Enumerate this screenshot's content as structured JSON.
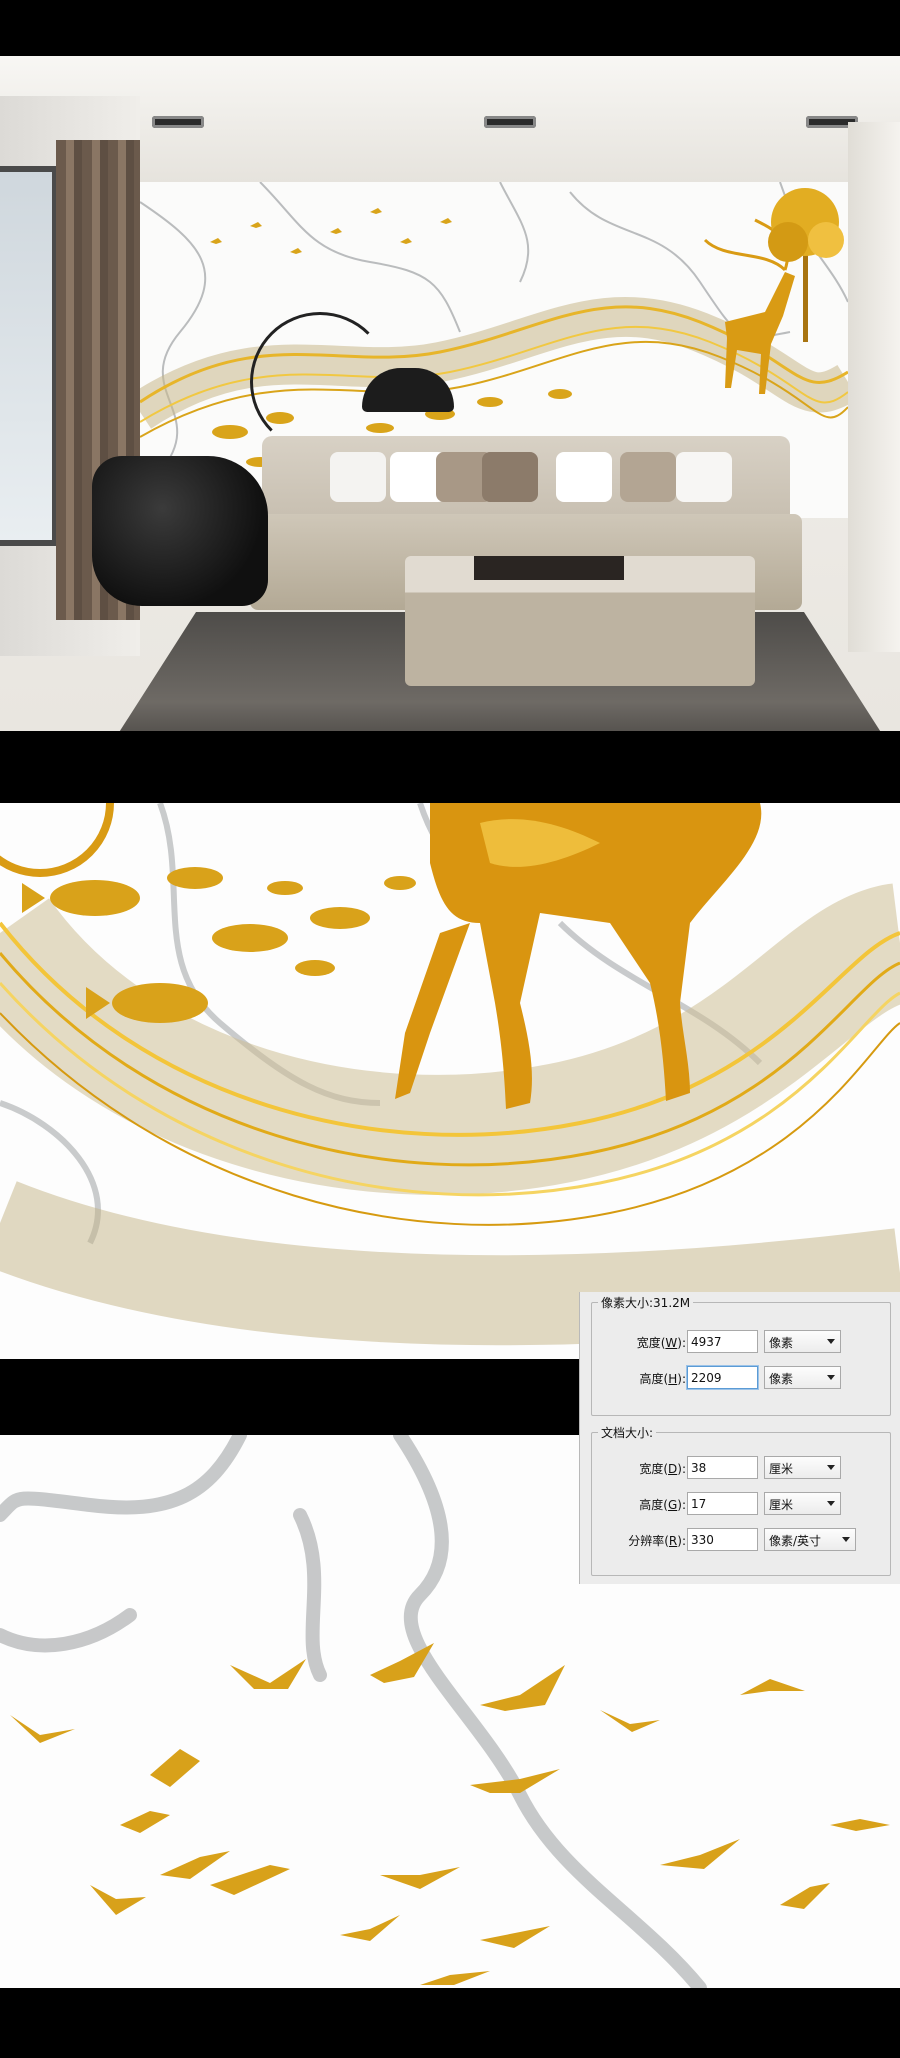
{
  "dialog": {
    "pixel_dimensions_title": "像素大小:31.2M",
    "document_size_title": "文档大小:",
    "pixel_width": {
      "label": "宽度",
      "key": "W",
      "value": "4937",
      "unit": "像素"
    },
    "pixel_height": {
      "label": "高度",
      "key": "H",
      "value": "2209",
      "unit": "像素"
    },
    "doc_width": {
      "label": "宽度",
      "key": "D",
      "value": "38",
      "unit": "厘米"
    },
    "doc_height": {
      "label": "高度",
      "key": "G",
      "value": "17",
      "unit": "厘米"
    },
    "resolution": {
      "label": "分辨率",
      "key": "R",
      "value": "330",
      "unit": "像素/英寸"
    }
  },
  "colors": {
    "gold": "#d8a21a",
    "gold_light": "#f2c845",
    "marble_vein": "#8f9396",
    "band": "#000000",
    "dialog_bg": "#ececec"
  },
  "icons": [
    "dropdown-caret-icon",
    "chain-link-icon"
  ]
}
